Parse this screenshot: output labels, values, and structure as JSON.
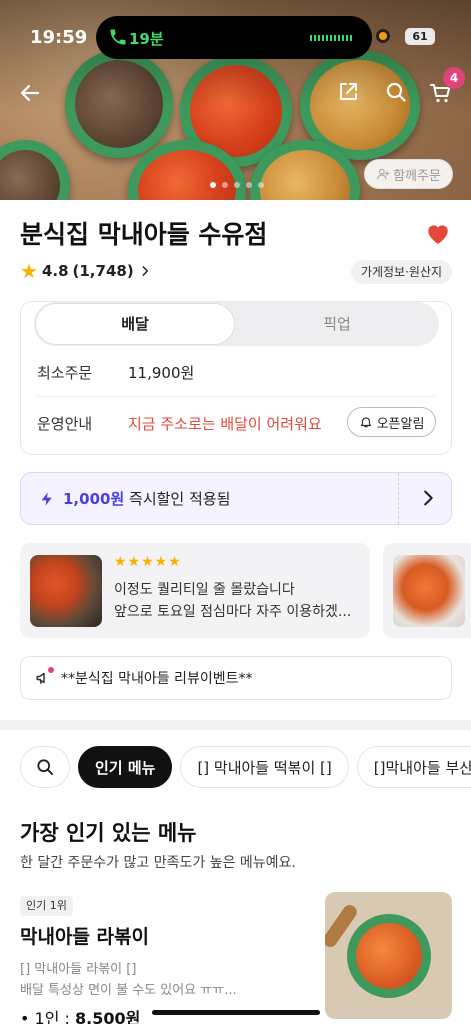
{
  "status_bar": {
    "time": "19:59",
    "call_duration": "19분",
    "battery": "61"
  },
  "hero": {
    "group_order_label": "함께주문",
    "cart_count": "4",
    "page_index": 1,
    "page_total": 5
  },
  "store": {
    "name": "분식집 막내아들 수유점",
    "rating": "4.8",
    "review_count": "(1,748)",
    "info_chip": "가게정보·원산지"
  },
  "delivery": {
    "tab_delivery": "배달",
    "tab_pickup": "픽업",
    "min_order_label": "최소주문",
    "min_order_value": "11,900원",
    "ops_label": "운영안내",
    "ops_warning": "지금 주소로는 배달이 어려워요",
    "open_alarm_label": "오픈알림",
    "warning_color": "#e5483a"
  },
  "discount": {
    "amount": "1,000원",
    "text": "즉시할인 적용됨",
    "accent_color": "#4a3fe0"
  },
  "review": {
    "stars": "★★★★★",
    "line1": "이정도 퀄리티일 줄 몰랐습니다",
    "line2": "앞으로 토요일 점심마다 자주 이용하겠..."
  },
  "notice": {
    "text": "**분식집 막내아들 리뷰이벤트**"
  },
  "category_chips": [
    {
      "label": "인기 메뉴",
      "active": true
    },
    {
      "label": "[] 막내아들 떡볶이 []",
      "active": false
    },
    {
      "label": "[]막내아들 부산",
      "active": false
    }
  ],
  "popular": {
    "title": "가장 인기 있는 메뉴",
    "subtitle": "한 달간 주문수가 많고 만족도가 높은 메뉴예요."
  },
  "menu_item": {
    "rank": "인기 1위",
    "name": "막내아들 라볶이",
    "desc1": "[] 막내아들 라볶이 []",
    "desc2": "배달 특성상 면이 불 수도 있어요 ㅠㅠ...",
    "price_prefix": "• 1인 :",
    "price": "8,500원"
  }
}
